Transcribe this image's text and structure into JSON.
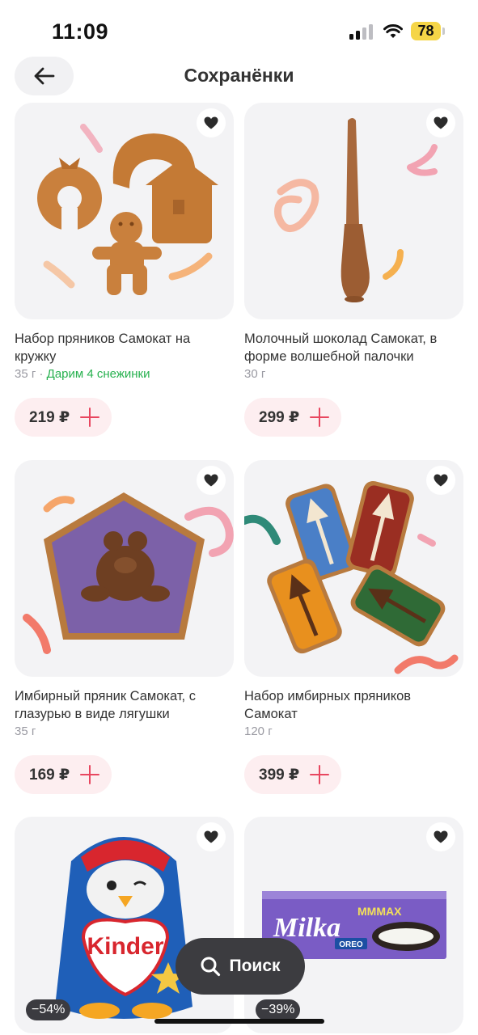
{
  "status_bar": {
    "time": "11:09",
    "battery": "78"
  },
  "header": {
    "title": "Сохранёнки"
  },
  "products": [
    {
      "title": "Набор пряников Самокат на кружку",
      "weight": "35 г",
      "promo": "Дарим 4 снежинки",
      "price": "219 ₽"
    },
    {
      "title": "Молочный шоколад Самокат, в форме волшебной палочки",
      "weight": "30 г",
      "price": "299 ₽"
    },
    {
      "title": "Имбирный пряник Самокат, с глазурью в виде лягушки",
      "weight": "35 г",
      "price": "169 ₽"
    },
    {
      "title": "Набор имбирных пряников Самокат",
      "weight": "120 г",
      "price": "399 ₽"
    },
    {
      "discount": "−54%",
      "brand_text": "Kinder"
    },
    {
      "discount": "−39%",
      "brand_text": "Milka",
      "sub_brand": "MMMAX",
      "oreo": "OREO"
    }
  ],
  "search": {
    "label": "Поиск"
  },
  "colors": {
    "accent": "#e8465f",
    "promo": "#27b14f",
    "price_bg": "#fdeef0",
    "card_bg": "#f3f3f5"
  },
  "icons": [
    "back-arrow-icon",
    "heart-icon",
    "plus-icon",
    "search-icon",
    "signal-icon",
    "wifi-icon",
    "battery-icon"
  ]
}
